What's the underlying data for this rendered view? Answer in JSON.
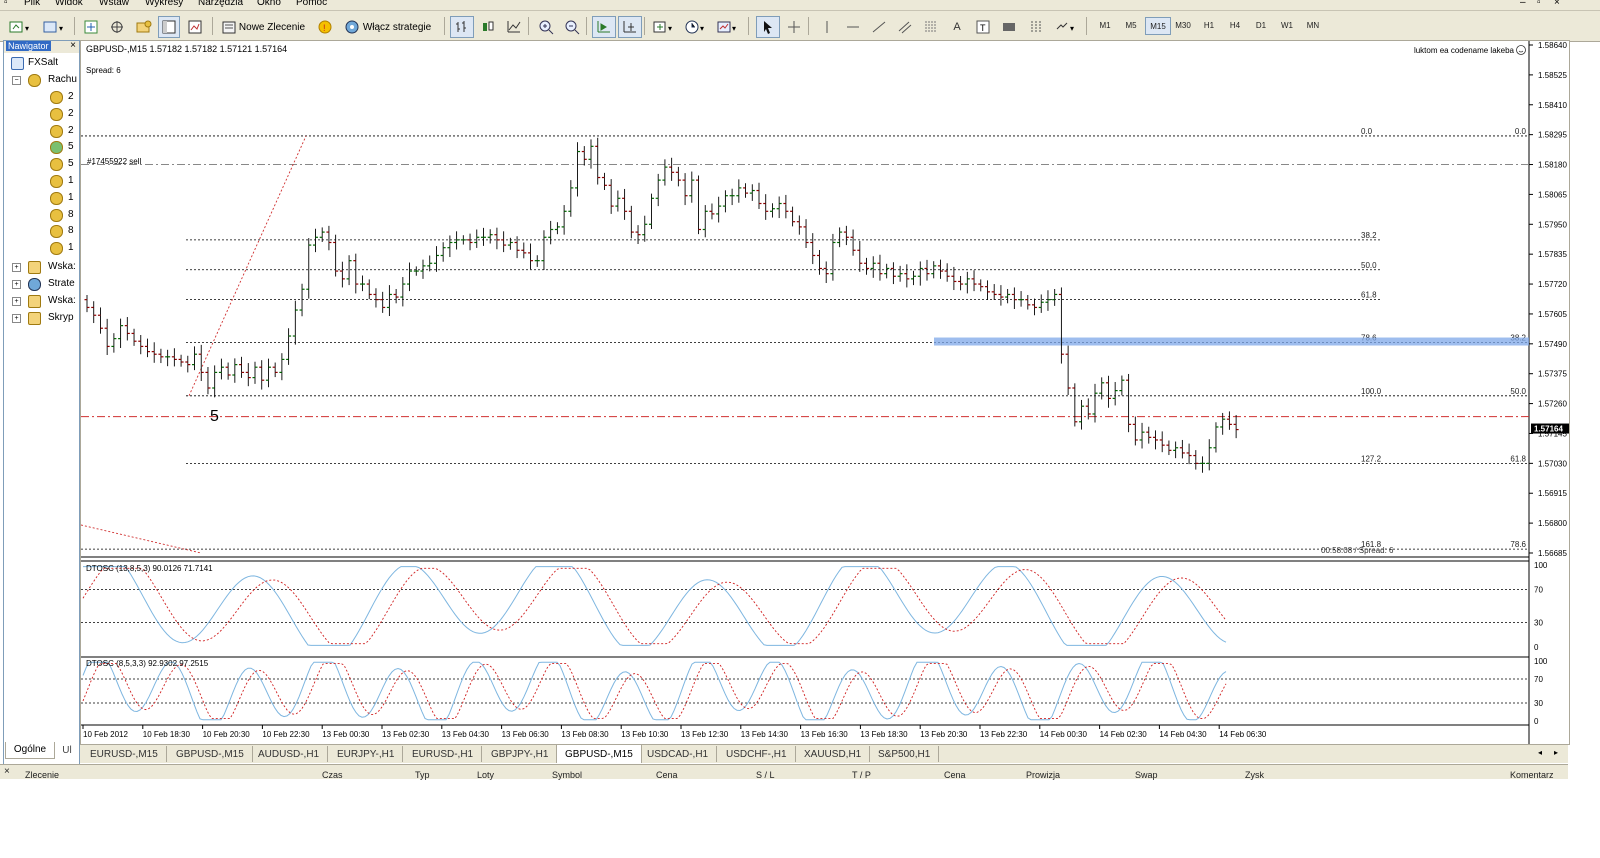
{
  "menu": [
    "Plik",
    "Widok",
    "Wstaw",
    "Wykresy",
    "Narzędzia",
    "Okno",
    "Pomoc"
  ],
  "toolbar": {
    "new_order": "Nowe Zlecenie",
    "enable_strategies": "Włącz strategie",
    "timeframes": [
      "M1",
      "M5",
      "M15",
      "M30",
      "H1",
      "H4",
      "D1",
      "W1",
      "MN"
    ],
    "active_timeframe": "M15"
  },
  "navigator": {
    "title": "Nawigator",
    "root": "FXSalt",
    "accounts_label": "Rachu",
    "accounts": [
      "2",
      "2",
      "2",
      "5",
      "5",
      "1",
      "1",
      "8",
      "8",
      "1"
    ],
    "folders": [
      "Wska:",
      "Strate",
      "Wska:",
      "Skryp"
    ],
    "tabs": [
      "Ogólne",
      "Ul"
    ]
  },
  "chart": {
    "header": "GBPUSD-,M15  1.57182 1.57182 1.57121 1.57164",
    "spread": "Spread: 6",
    "ea_label": "luktom ea codename lakeba",
    "order_label": "#17455922 sell",
    "wave_label": "5",
    "current_price": "1.57164",
    "price_ticks": [
      "1.58640",
      "1.58525",
      "1.58410",
      "1.58295",
      "1.58180",
      "1.58065",
      "1.57950",
      "1.57835",
      "1.57720",
      "1.57605",
      "1.57490",
      "1.57375",
      "1.57260",
      "1.57145",
      "1.57030",
      "1.56915",
      "1.56800",
      "1.56685"
    ],
    "fib_left": [
      "0.0",
      "38.2",
      "50.0",
      "61.8",
      "78.6",
      "100.0",
      "127.2",
      "161.8"
    ],
    "fib_right": [
      "0.0",
      "38.2",
      "50.0",
      "61.8",
      "78.6"
    ],
    "bottom_info": "00:58:08 / Spread: 6",
    "time_labels": [
      "10 Feb 2012",
      "10 Feb 18:30",
      "10 Feb 20:30",
      "10 Feb 22:30",
      "13 Feb 00:30",
      "13 Feb 02:30",
      "13 Feb 04:30",
      "13 Feb 06:30",
      "13 Feb 08:30",
      "13 Feb 10:30",
      "13 Feb 12:30",
      "13 Feb 14:30",
      "13 Feb 16:30",
      "13 Feb 18:30",
      "13 Feb 20:30",
      "13 Feb 22:30",
      "14 Feb 00:30",
      "14 Feb 02:30",
      "14 Feb 04:30",
      "14 Feb 06:30"
    ]
  },
  "indicator1": {
    "label": "DTOSC (13,8,5,3) 90.0126 71.7141",
    "levels": [
      "100",
      "70",
      "30",
      "0"
    ]
  },
  "indicator2": {
    "label": "DTOSC (8,5,3,3) 92.9302 97.2515",
    "levels": [
      "100",
      "70",
      "30",
      "0"
    ]
  },
  "chart_tabs": [
    "EURUSD-,M15",
    "GBPUSD-,M15",
    "AUDUSD-,H1",
    "EURJPY-,H1",
    "EURUSD-,H1",
    "GBPJPY-,H1",
    "GBPUSD-,M15",
    "USDCAD-,H1",
    "USDCHF-,H1",
    "XAUUSD,H1",
    "S&P500,H1"
  ],
  "active_chart_tab": "GBPUSD-,M15",
  "terminal_columns": [
    "Zlecenie",
    "Czas",
    "Typ",
    "Loty",
    "Symbol",
    "Cena",
    "S / L",
    "T / P",
    "Cena",
    "Prowizja",
    "Swap",
    "Zysk",
    "Komentarz"
  ],
  "colors": {
    "up": "#006400",
    "down": "#8b0000",
    "main_line": "#7eb6e0",
    "signal_line": "#d02020",
    "zone": "#7da7e8",
    "window_bg": "#ece9d8",
    "nav_select": "#316ac5"
  }
}
